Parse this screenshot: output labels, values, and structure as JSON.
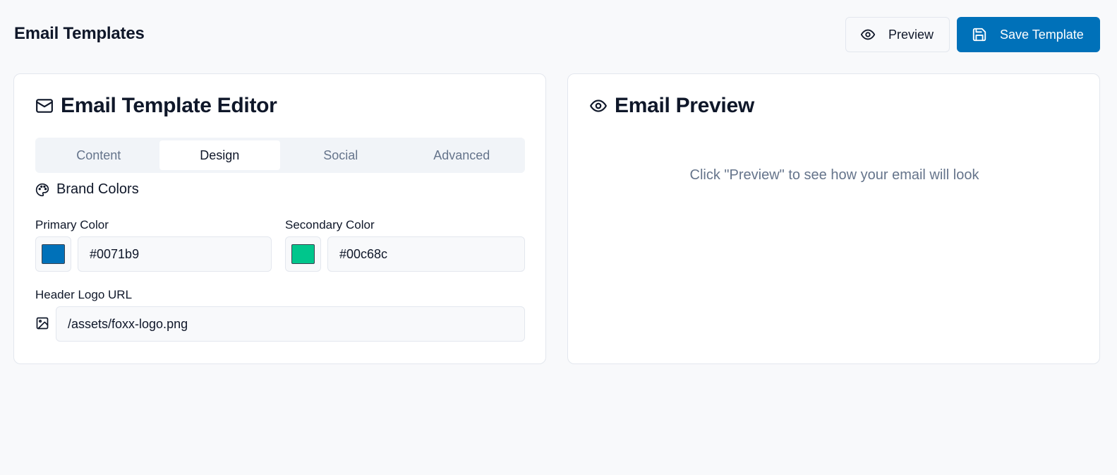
{
  "header": {
    "title": "Email Templates",
    "preview_label": "Preview",
    "save_label": "Save Template"
  },
  "editor": {
    "title": "Email Template Editor",
    "tabs": [
      {
        "label": "Content",
        "active": false
      },
      {
        "label": "Design",
        "active": true
      },
      {
        "label": "Social",
        "active": false
      },
      {
        "label": "Advanced",
        "active": false
      }
    ],
    "brand_colors": {
      "title": "Brand Colors",
      "primary": {
        "label": "Primary Color",
        "value": "#0071b9",
        "swatch": "#0071b9"
      },
      "secondary": {
        "label": "Secondary Color",
        "value": "#00c68c",
        "swatch": "#00c68c"
      }
    },
    "logo": {
      "label": "Header Logo URL",
      "value": "/assets/foxx-logo.png"
    }
  },
  "preview": {
    "title": "Email Preview",
    "placeholder": "Click \"Preview\" to see how your email will look"
  },
  "colors": {
    "accent": "#0071b9",
    "muted_text": "#65748b",
    "border": "#e3e7ee",
    "background": "#f8f9fb"
  },
  "icons": [
    "eye-icon",
    "save-icon",
    "mail-icon",
    "palette-icon",
    "image-icon"
  ]
}
